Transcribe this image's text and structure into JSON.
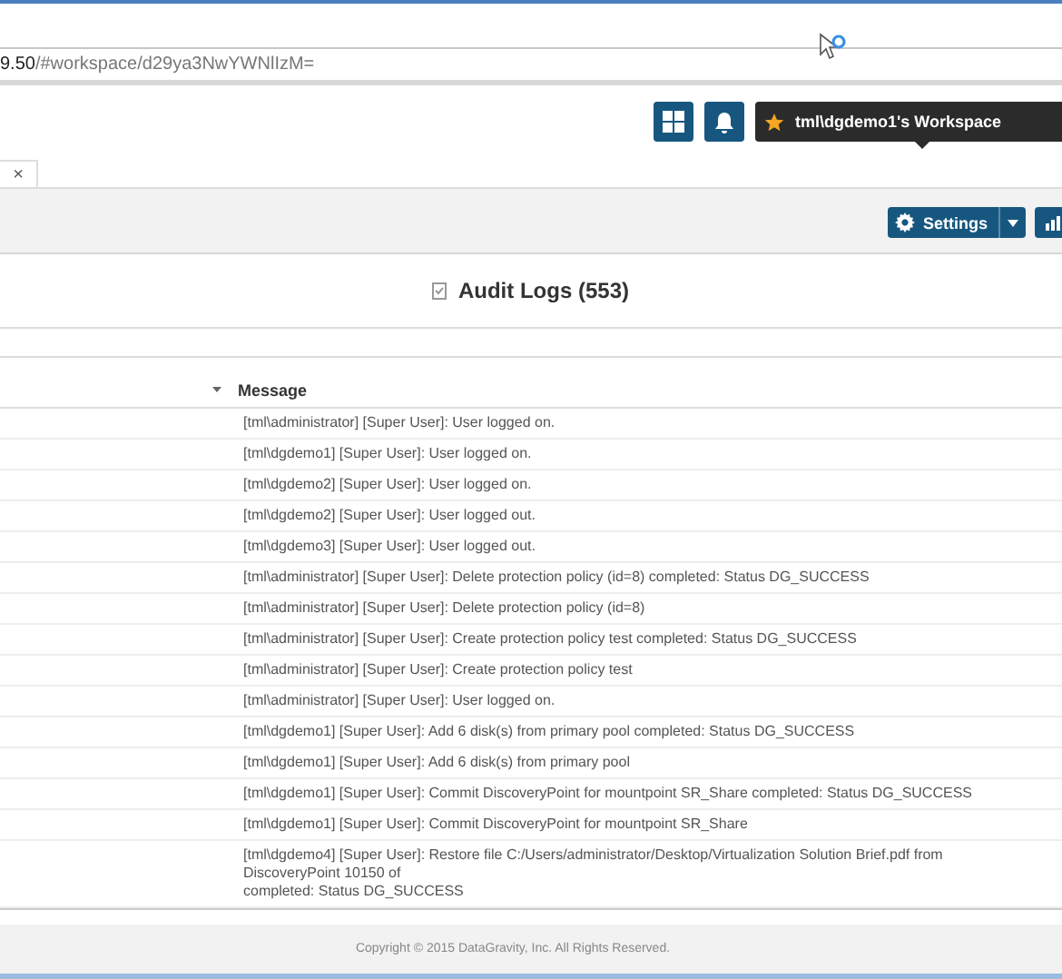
{
  "browser": {
    "address": {
      "host": "9.50",
      "path": "/#workspace/d29ya3NwYWNlIzM="
    }
  },
  "header": {
    "workspace_tooltip": "tml\\dgdemo1's Workspace"
  },
  "tab_strip": {
    "close": "×"
  },
  "toolbar": {
    "settings_button": "Settings"
  },
  "panel": {
    "title": "Audit Logs (553)",
    "table": {
      "columns": [
        "Message"
      ],
      "rows": [
        {
          "lines": [
            "[tml\\administrator] [Super User]: User logged on."
          ]
        },
        {
          "lines": [
            "[tml\\dgdemo1] [Super User]: User logged on."
          ]
        },
        {
          "lines": [
            "[tml\\dgdemo2] [Super User]: User logged on."
          ]
        },
        {
          "lines": [
            "[tml\\dgdemo2] [Super User]: User logged out."
          ]
        },
        {
          "lines": [
            "[tml\\dgdemo3] [Super User]: User logged out."
          ]
        },
        {
          "lines": [
            "[tml\\administrator] [Super User]: Delete protection policy (id=8) completed: Status DG_SUCCESS"
          ]
        },
        {
          "lines": [
            "[tml\\administrator] [Super User]: Delete protection policy (id=8)"
          ]
        },
        {
          "lines": [
            "[tml\\administrator] [Super User]: Create protection policy test completed: Status DG_SUCCESS"
          ]
        },
        {
          "lines": [
            "[tml\\administrator] [Super User]: Create protection policy test"
          ]
        },
        {
          "lines": [
            "[tml\\administrator] [Super User]: User logged on."
          ]
        },
        {
          "lines": [
            "[tml\\dgdemo1] [Super User]: Add 6 disk(s) from primary pool completed: Status DG_SUCCESS"
          ]
        },
        {
          "lines": [
            "[tml\\dgdemo1] [Super User]: Add 6 disk(s) from primary pool"
          ]
        },
        {
          "lines": [
            "[tml\\dgdemo1] [Super User]: Commit DiscoveryPoint for mountpoint SR_Share completed: Status DG_SUCCESS"
          ]
        },
        {
          "lines": [
            "[tml\\dgdemo1] [Super User]: Commit DiscoveryPoint for mountpoint SR_Share"
          ]
        },
        {
          "lines": [
            "[tml\\dgdemo4] [Super User]: Restore file C:/Users/administrator/Desktop/Virtualization Solution Brief.pdf from DiscoveryPoint 10150 of",
            "completed: Status DG_SUCCESS"
          ]
        }
      ]
    }
  },
  "footer": {
    "copyright": "Copyright © 2015 DataGravity, Inc. All Rights Reserved."
  }
}
